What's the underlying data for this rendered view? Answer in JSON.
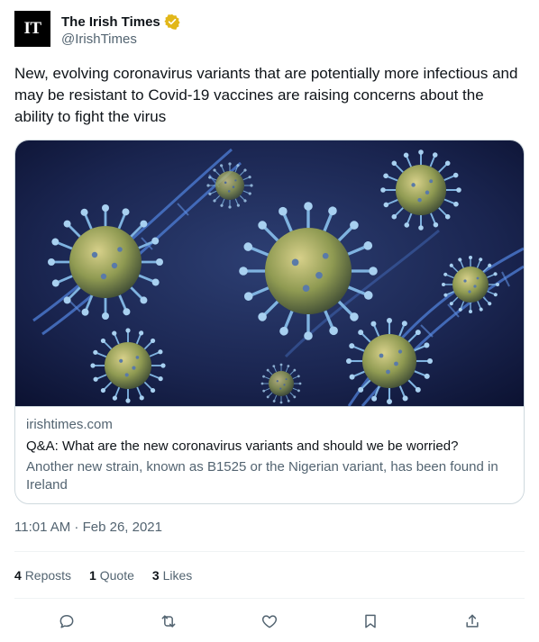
{
  "account": {
    "avatar_text": "IT",
    "display_name": "The Irish Times",
    "handle": "@IrishTimes",
    "verified_color": "#e2b719"
  },
  "tweet": {
    "text": "New, evolving coronavirus variants that are potentially more infectious and may be resistant to Covid-19 vaccines are raising concerns about the ability to fight the virus"
  },
  "card": {
    "image_icon": "coronavirus-image",
    "domain": "irishtimes.com",
    "title": "Q&A: What are the new coronavirus variants and should we be worried?",
    "description": "Another new strain, known as B1525 or the Nigerian variant, has been found in Ireland"
  },
  "timestamp": "11:01 AM · Feb 26, 2021",
  "stats": {
    "reposts_count": "4",
    "reposts_label": "Reposts",
    "quotes_count": "1",
    "quotes_label": "Quote",
    "likes_count": "3",
    "likes_label": "Likes"
  },
  "actions": [
    "reply-icon",
    "retweet-icon",
    "like-icon",
    "bookmark-icon",
    "share-icon"
  ]
}
